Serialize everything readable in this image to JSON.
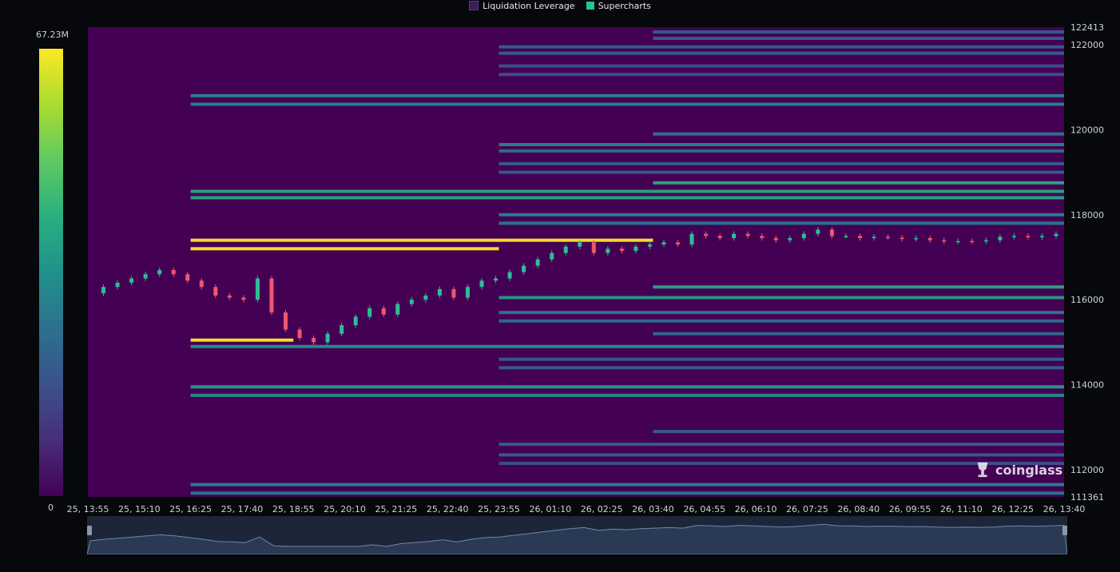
{
  "legend": [
    {
      "label": "Liquidation Leverage",
      "color": "#3d1a5b"
    },
    {
      "label": "Supercharts",
      "color": "#22c58b"
    }
  ],
  "colorbar": {
    "max_label": "67.23M",
    "min_label": "0"
  },
  "watermark": {
    "text": "coinglass",
    "icon": "coinglass-logo-icon"
  },
  "colors": {
    "background": "#440154",
    "up": "#2dbd96",
    "down": "#f0576e",
    "highlight": "#fde725"
  },
  "chart_data": {
    "type": "heatmap",
    "title": "",
    "x_tick_labels": [
      "25, 13:55",
      "25, 15:10",
      "25, 16:25",
      "25, 17:40",
      "25, 18:55",
      "25, 20:10",
      "25, 21:25",
      "25, 22:40",
      "25, 23:55",
      "26, 01:10",
      "26, 02:25",
      "26, 03:40",
      "26, 04:55",
      "26, 06:10",
      "26, 07:25",
      "26, 08:40",
      "26, 09:55",
      "26, 11:10",
      "26, 12:25",
      "26, 13:40"
    ],
    "y_tick_labels": [
      "122413",
      "122000",
      "120000",
      "118000",
      "116000",
      "114000",
      "112000",
      "111361"
    ],
    "ylim": [
      111361,
      122413
    ],
    "y_ticks": [
      122413,
      122000,
      120000,
      118000,
      116000,
      114000,
      112000,
      111361
    ],
    "value_range": [
      0,
      67230000
    ],
    "price_path": [
      [
        0,
        116150
      ],
      [
        1,
        116300
      ],
      [
        2,
        116400
      ],
      [
        3,
        116500
      ],
      [
        4,
        116600
      ],
      [
        5,
        116700
      ],
      [
        6,
        116600
      ],
      [
        7,
        116450
      ],
      [
        8,
        116300
      ],
      [
        9,
        116100
      ],
      [
        10,
        116050
      ],
      [
        11,
        116000
      ],
      [
        12,
        116500
      ],
      [
        13,
        115700
      ],
      [
        14,
        115300
      ],
      [
        15,
        115100
      ],
      [
        16,
        115000
      ],
      [
        17,
        115200
      ],
      [
        18,
        115400
      ],
      [
        19,
        115600
      ],
      [
        20,
        115800
      ],
      [
        21,
        115650
      ],
      [
        22,
        115900
      ],
      [
        23,
        116000
      ],
      [
        24,
        116100
      ],
      [
        25,
        116250
      ],
      [
        26,
        116050
      ],
      [
        27,
        116300
      ],
      [
        28,
        116450
      ],
      [
        29,
        116500
      ],
      [
        30,
        116650
      ],
      [
        31,
        116800
      ],
      [
        32,
        116950
      ],
      [
        33,
        117100
      ],
      [
        34,
        117250
      ],
      [
        35,
        117350
      ],
      [
        36,
        117100
      ],
      [
        37,
        117200
      ],
      [
        38,
        117150
      ],
      [
        39,
        117250
      ],
      [
        40,
        117300
      ],
      [
        41,
        117350
      ],
      [
        42,
        117300
      ],
      [
        43,
        117550
      ],
      [
        44,
        117500
      ],
      [
        45,
        117450
      ],
      [
        46,
        117550
      ],
      [
        47,
        117500
      ],
      [
        48,
        117450
      ],
      [
        49,
        117400
      ],
      [
        50,
        117450
      ],
      [
        51,
        117550
      ],
      [
        52,
        117650
      ],
      [
        53,
        117500
      ],
      [
        54,
        117500
      ],
      [
        55,
        117450
      ],
      [
        56,
        117480
      ],
      [
        57,
        117460
      ],
      [
        58,
        117430
      ],
      [
        59,
        117450
      ],
      [
        60,
        117400
      ],
      [
        61,
        117370
      ],
      [
        62,
        117380
      ],
      [
        63,
        117370
      ],
      [
        64,
        117400
      ],
      [
        65,
        117480
      ],
      [
        66,
        117500
      ],
      [
        67,
        117470
      ],
      [
        68,
        117500
      ],
      [
        69,
        117550
      ]
    ],
    "liquidation_bands": [
      {
        "price": 122300,
        "start": "26, 03:40",
        "end": "26, 13:40",
        "intensity": 0.3
      },
      {
        "price": 122150,
        "start": "26, 03:40",
        "end": "26, 13:40",
        "intensity": 0.3
      },
      {
        "price": 121950,
        "start": "25, 23:55",
        "end": "26, 13:40",
        "intensity": 0.3
      },
      {
        "price": 121800,
        "start": "25, 23:55",
        "end": "26, 13:40",
        "intensity": 0.3
      },
      {
        "price": 121500,
        "start": "25, 23:55",
        "end": "26, 13:40",
        "intensity": 0.25
      },
      {
        "price": 121300,
        "start": "25, 23:55",
        "end": "26, 13:40",
        "intensity": 0.25
      },
      {
        "price": 120800,
        "start": "25, 16:25",
        "end": "26, 13:40",
        "intensity": 0.45
      },
      {
        "price": 120600,
        "start": "25, 16:25",
        "end": "26, 13:40",
        "intensity": 0.45
      },
      {
        "price": 119900,
        "start": "26, 03:40",
        "end": "26, 13:40",
        "intensity": 0.4
      },
      {
        "price": 119650,
        "start": "25, 23:55",
        "end": "26, 13:40",
        "intensity": 0.45
      },
      {
        "price": 119500,
        "start": "25, 23:55",
        "end": "26, 13:40",
        "intensity": 0.35
      },
      {
        "price": 119200,
        "start": "25, 23:55",
        "end": "26, 13:40",
        "intensity": 0.3
      },
      {
        "price": 119000,
        "start": "25, 23:55",
        "end": "26, 13:40",
        "intensity": 0.3
      },
      {
        "price": 118750,
        "start": "26, 03:40",
        "end": "26, 13:40",
        "intensity": 0.6
      },
      {
        "price": 118550,
        "start": "25, 16:25",
        "end": "26, 13:40",
        "intensity": 0.6
      },
      {
        "price": 118400,
        "start": "25, 16:25",
        "end": "26, 13:40",
        "intensity": 0.6
      },
      {
        "price": 118000,
        "start": "25, 23:55",
        "end": "26, 13:40",
        "intensity": 0.45
      },
      {
        "price": 117800,
        "start": "25, 23:55",
        "end": "26, 13:40",
        "intensity": 0.4
      },
      {
        "price": 117400,
        "start": "25, 16:25",
        "end": "26, 03:40",
        "intensity": 1.0
      },
      {
        "price": 117200,
        "start": "25, 16:25",
        "end": "25, 23:55",
        "intensity": 1.0
      },
      {
        "price": 116300,
        "start": "26, 03:40",
        "end": "26, 13:40",
        "intensity": 0.6
      },
      {
        "price": 116050,
        "start": "25, 23:55",
        "end": "26, 13:40",
        "intensity": 0.55
      },
      {
        "price": 115700,
        "start": "25, 23:55",
        "end": "26, 13:40",
        "intensity": 0.4
      },
      {
        "price": 115500,
        "start": "25, 23:55",
        "end": "26, 13:40",
        "intensity": 0.35
      },
      {
        "price": 115200,
        "start": "26, 03:40",
        "end": "26, 13:40",
        "intensity": 0.35
      },
      {
        "price": 115050,
        "start": "25, 16:25",
        "end": "25, 18:55",
        "intensity": 1.0
      },
      {
        "price": 114900,
        "start": "25, 16:25",
        "end": "26, 13:40",
        "intensity": 0.5
      },
      {
        "price": 114600,
        "start": "25, 23:55",
        "end": "26, 13:40",
        "intensity": 0.3
      },
      {
        "price": 114400,
        "start": "25, 23:55",
        "end": "26, 13:40",
        "intensity": 0.3
      },
      {
        "price": 113950,
        "start": "25, 16:25",
        "end": "26, 13:40",
        "intensity": 0.55
      },
      {
        "price": 113750,
        "start": "25, 16:25",
        "end": "26, 13:40",
        "intensity": 0.5
      },
      {
        "price": 112900,
        "start": "26, 03:40",
        "end": "26, 13:40",
        "intensity": 0.3
      },
      {
        "price": 112600,
        "start": "25, 23:55",
        "end": "26, 13:40",
        "intensity": 0.3
      },
      {
        "price": 112350,
        "start": "25, 23:55",
        "end": "26, 13:40",
        "intensity": 0.3
      },
      {
        "price": 112150,
        "start": "25, 23:55",
        "end": "26, 13:40",
        "intensity": 0.25
      },
      {
        "price": 111650,
        "start": "25, 16:25",
        "end": "26, 13:40",
        "intensity": 0.45
      },
      {
        "price": 111450,
        "start": "25, 16:25",
        "end": "26, 13:40",
        "intensity": 0.4
      }
    ]
  }
}
